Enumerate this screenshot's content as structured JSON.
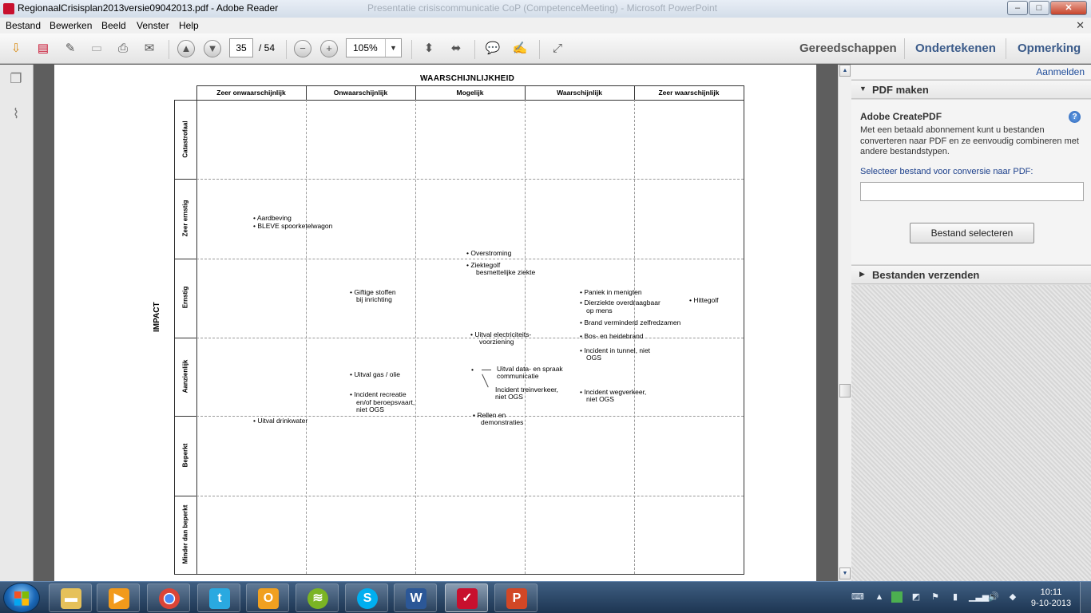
{
  "window": {
    "title": "RegionaalCrisisplan2013versie09042013.pdf - Adobe Reader",
    "background_window_title": "Presentatie crisiscommunicatie CoP (CompetenceMeeting) - Microsoft PowerPoint",
    "minimize": "‒",
    "maximize": "□",
    "close": "✕"
  },
  "menu": [
    "Bestand",
    "Bewerken",
    "Beeld",
    "Venster",
    "Help"
  ],
  "menu_close": "✕",
  "toolbar": {
    "current_page": "35",
    "total_pages": "/ 54",
    "zoom": "105%",
    "links": [
      "Gereedschappen",
      "Ondertekenen",
      "Opmerking"
    ],
    "icons": [
      "open-icon",
      "create-pdf-icon",
      "edit-icon",
      "save-icon",
      "print-icon",
      "email-icon",
      "previous-page-icon",
      "next-page-icon",
      "zoom-out-icon",
      "zoom-in-icon",
      "fit-page-icon",
      "fit-width-icon",
      "comment-icon",
      "highlight-icon",
      "full-screen-icon"
    ]
  },
  "left_pane": {
    "icons": [
      "pages-icon",
      "attachment-icon"
    ]
  },
  "document": {
    "heading": "WAARSCHIJNLIJKHEID",
    "axis_label": "IMPACT",
    "columns": [
      "Zeer onwaarschijnlijk",
      "Onwaarschijnlijk",
      "Mogelijk",
      "Waarschijnlijk",
      "Zeer waarschijnlijk"
    ],
    "rows": [
      "Catastrofaal",
      "Zeer ernstig",
      "Ernstig",
      "Aanzienlijk",
      "Beperkt",
      "Minder dan beperkt"
    ],
    "entries": {
      "aardbeving": "• Aardbeving",
      "bleve": "• BLEVE spoorketelwagon",
      "overstroming": "• Overstroming",
      "ziektegolf_1": "• Ziektegolf",
      "ziektegolf_2": "besmettelijke ziekte",
      "giftige_1": "• Giftige stoffen",
      "giftige_2": "bij inrichting",
      "paniek": "• Paniek in menigten",
      "hittegolf": "• Hittegolf",
      "dierziekte_1": "• Dierziekte overdraagbaar",
      "dierziekte_2": "op mens",
      "zelfredzamen": "• Brand verminderd zelfredzamen",
      "elektriciteit_1": "• Uitval electriciteits-",
      "elektriciteit_2": "voorziening",
      "bosbrand": "• Bos- en heidebrand",
      "tunnel_1": "• Incident in tunnel, niet",
      "tunnel_2": "OGS",
      "gas": "• Uitval gas / olie",
      "data_bullet": "•",
      "data_1": "Uitval data- en spraak",
      "data_2": "communicatie",
      "trein_1": "Incident treinverkeer,",
      "trein_2": "niet OGS",
      "recreatie_1": "• Incident recreatie",
      "recreatie_2": "en/of beroepsvaart,",
      "recreatie_3": "niet OGS",
      "wegverkeer_1": "• Incident wegverkeer,",
      "wegverkeer_2": "niet OGS",
      "drinkwater": "• Uitval drinkwater",
      "rellen_1": "• Rellen en",
      "rellen_2": "demonstraties"
    }
  },
  "right_pane": {
    "login": "Aanmelden",
    "section_pdf": "PDF maken",
    "service_title": "Adobe CreatePDF",
    "help": "?",
    "description": "Met een betaald abonnement kunt u bestanden converteren naar PDF en ze eenvoudig combineren met andere bestandstypen.",
    "select_label": "Selecteer bestand voor conversie naar PDF:",
    "select_button": "Bestand selecteren",
    "section_send": "Bestanden verzenden"
  },
  "taskbar": {
    "apps": [
      "explorer",
      "media-player",
      "chrome",
      "twitter",
      "outlook",
      "spotify",
      "skype",
      "word",
      "adobe-reader",
      "powerpoint"
    ],
    "clock_time": "10:11",
    "clock_date": "9-10-2013"
  },
  "colors": {
    "title_bar": "#dce6f1",
    "accent_blue": "#1e4c9a",
    "taskbar": "#2a4566",
    "close_button": "#c7432b"
  }
}
